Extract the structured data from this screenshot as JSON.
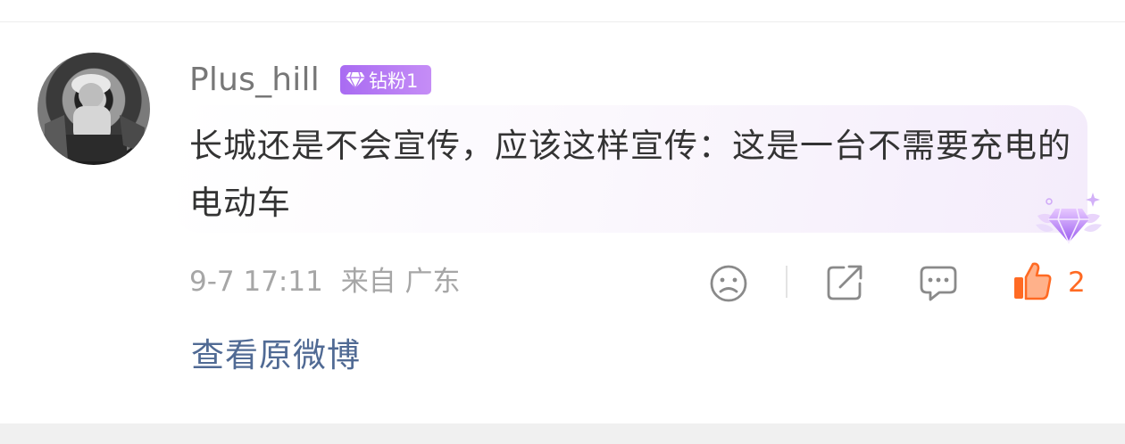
{
  "comment": {
    "username": "Plus_hill",
    "badge_label": "钻粉1",
    "text": "长城还是不会宣传，应该这样宣传：这是一台不需要充电的电动车",
    "timestamp": "9-7 17:11",
    "location": "来自 广东",
    "like_count": "2"
  },
  "footer": {
    "view_original_label": "查看原微博"
  },
  "icons": {
    "avatar": "user-avatar-photo",
    "badge": "diamond-icon",
    "decoration": "diamond-wings-icon",
    "dislike": "sad-face-icon",
    "share": "share-icon",
    "comment": "comment-icon",
    "like": "thumbs-up-icon"
  },
  "colors": {
    "username": "#777777",
    "badge_gradient_start": "#a96bf2",
    "badge_gradient_end": "#c58df6",
    "like_accent": "#ff6a23",
    "link": "#506a94",
    "meta": "#a6a6a6"
  }
}
